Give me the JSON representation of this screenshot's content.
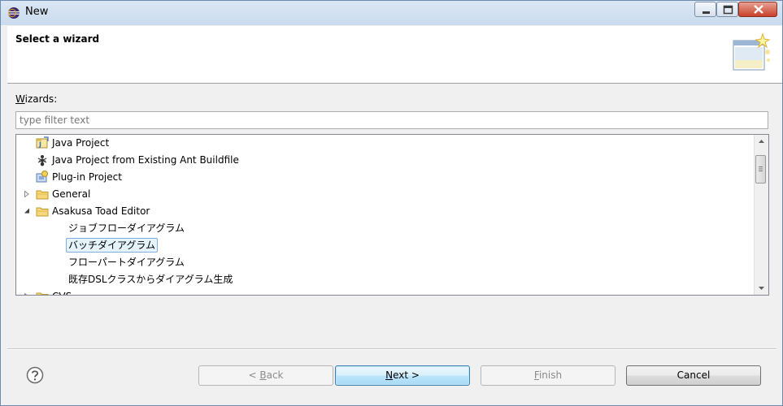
{
  "window": {
    "title": "New",
    "title_icon": "eclipse-icon"
  },
  "header": {
    "title": "Select a wizard",
    "graphic": "wizard-banner-icon"
  },
  "wizards_label": {
    "mnemonic": "W",
    "rest": "izards:"
  },
  "filter": {
    "placeholder": "type filter text",
    "value": ""
  },
  "tree": {
    "items": [
      {
        "label": "Java Project",
        "icon": "java-project-icon",
        "level": 0,
        "expandable": false
      },
      {
        "label": "Java Project from Existing Ant Buildfile",
        "icon": "ant-icon",
        "level": 0,
        "expandable": false
      },
      {
        "label": "Plug-in Project",
        "icon": "plugin-project-icon",
        "level": 0,
        "expandable": false
      },
      {
        "label": "General",
        "icon": "folder-icon",
        "level": 0,
        "expandable": true,
        "expanded": false
      },
      {
        "label": "Asakusa Toad Editor",
        "icon": "folder-icon",
        "level": 0,
        "expandable": true,
        "expanded": true
      },
      {
        "label": "ジョブフローダイアグラム",
        "icon": "",
        "level": 1,
        "expandable": false
      },
      {
        "label": "バッチダイアグラム",
        "icon": "",
        "level": 1,
        "expandable": false,
        "selected": true
      },
      {
        "label": "フローパートダイアグラム",
        "icon": "",
        "level": 1,
        "expandable": false
      },
      {
        "label": "既存DSLクラスからダイアグラム生成",
        "icon": "",
        "level": 1,
        "expandable": false
      },
      {
        "label": "CVS",
        "icon": "folder-icon",
        "level": 0,
        "expandable": true,
        "expanded": false,
        "partially_visible": true
      }
    ]
  },
  "buttons": {
    "back": {
      "prefix": "< ",
      "mnemonic": "B",
      "rest": "ack",
      "enabled": false
    },
    "next": {
      "mnemonic": "N",
      "rest": "ext >",
      "enabled": true
    },
    "finish": {
      "mnemonic": "F",
      "rest": "inish",
      "enabled": false
    },
    "cancel": {
      "label": "Cancel",
      "enabled": true
    }
  },
  "colors": {
    "selection_bg": "#e5f3fb",
    "selection_border": "#84acdd",
    "default_button": "#3c7fb1"
  }
}
